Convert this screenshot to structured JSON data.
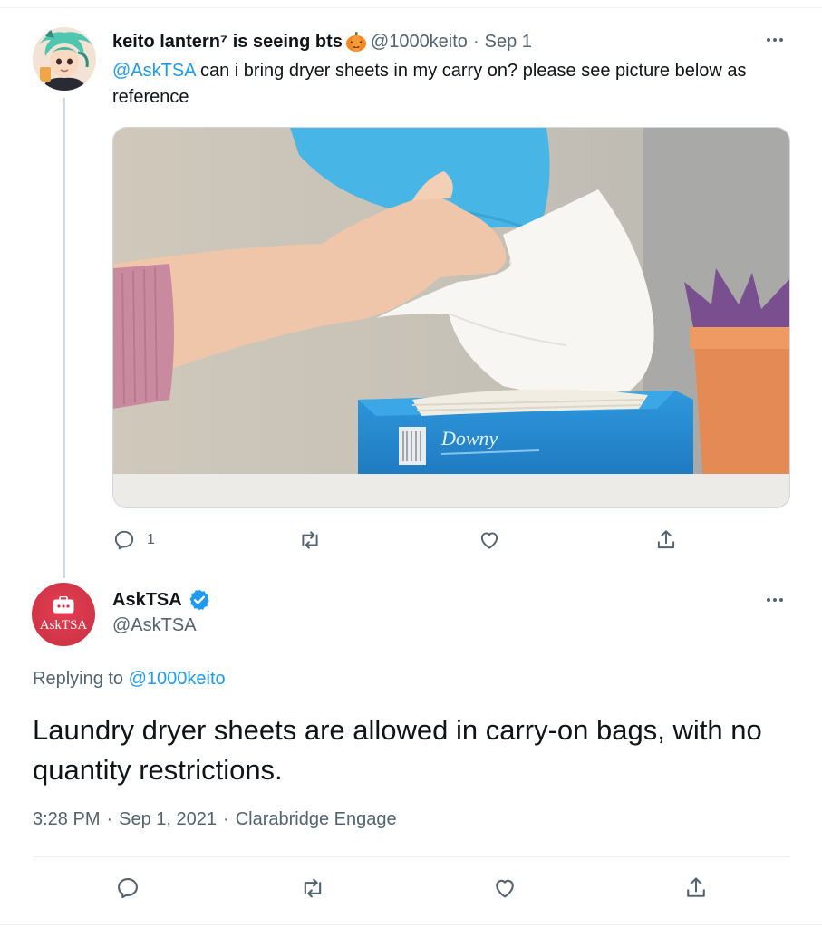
{
  "tweet1": {
    "display_name": "keito lantern⁷ is seeing bts",
    "handle": "@1000keito",
    "separator": "·",
    "date": "Sep 1",
    "mention": "@AskTSA",
    "text": " can i bring dryer sheets in my carry on? please see picture below as reference",
    "media_box_text": "Downy",
    "reply_count": "1"
  },
  "tweet2": {
    "display_name": "AskTSA",
    "handle": "@AskTSA",
    "avatar_text": "AskTSA",
    "replying_prefix": "Replying to ",
    "replying_handle": "@1000keito",
    "text": "Laundry dryer sheets are allowed in carry-on bags, with no quantity restrictions.",
    "time": "3:28 PM",
    "sep": "·",
    "date": "Sep 1, 2021",
    "source": "Clarabridge Engage"
  },
  "colors": {
    "accent": "#1d9bf0",
    "text": "#0f1419",
    "muted": "#536471",
    "border": "#eff3f4",
    "avatar_red": "#d33647"
  },
  "icons": [
    "more-icon",
    "pumpkin-icon",
    "verified-badge-icon",
    "reply-icon",
    "retweet-icon",
    "like-icon",
    "share-icon",
    "briefcase-icon"
  ]
}
